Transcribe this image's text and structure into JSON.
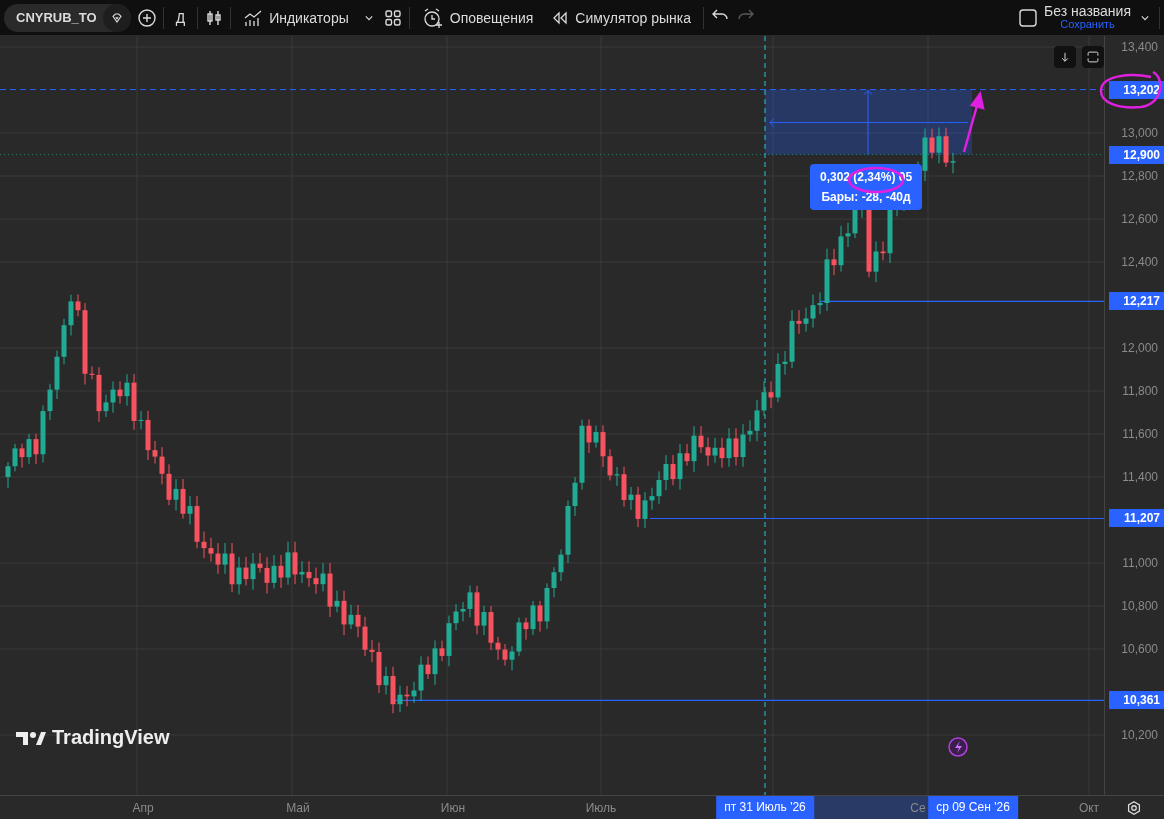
{
  "toolbar": {
    "symbol": "CNYRUB_TO",
    "interval": "Д",
    "indicators": "Индикаторы",
    "alerts": "Оповещения",
    "replay": "Симулятор рынка",
    "undo": {
      "disabled": false
    },
    "redo": {
      "disabled": true
    },
    "layout_title": "Без названия",
    "save": "Сохранить"
  },
  "chart": {
    "price_axis": [
      "13,400",
      "13,000",
      "12,800",
      "12,600",
      "12,400",
      "12,000",
      "11,800",
      "11,600",
      "11,400",
      "11,000",
      "10,800",
      "10,600",
      "10,200"
    ],
    "price_lines": [
      {
        "label": "13,202",
        "kind": "target"
      },
      {
        "label": "12,900",
        "kind": "current"
      },
      {
        "label": "12,217",
        "kind": "level"
      },
      {
        "label": "11,207",
        "kind": "level"
      },
      {
        "label": "10,361",
        "kind": "level"
      }
    ],
    "measure": {
      "value": "0,302 (2,34%) 05",
      "bars": "Бары: -28, -40д"
    },
    "logo": "TradingView",
    "time_axis": [
      "Апр",
      "Май",
      "Июн",
      "Июль",
      "Се",
      "Окт"
    ],
    "date_badges": [
      "пт 31 Июль '26",
      "ср 09 Сен '26"
    ]
  }
}
